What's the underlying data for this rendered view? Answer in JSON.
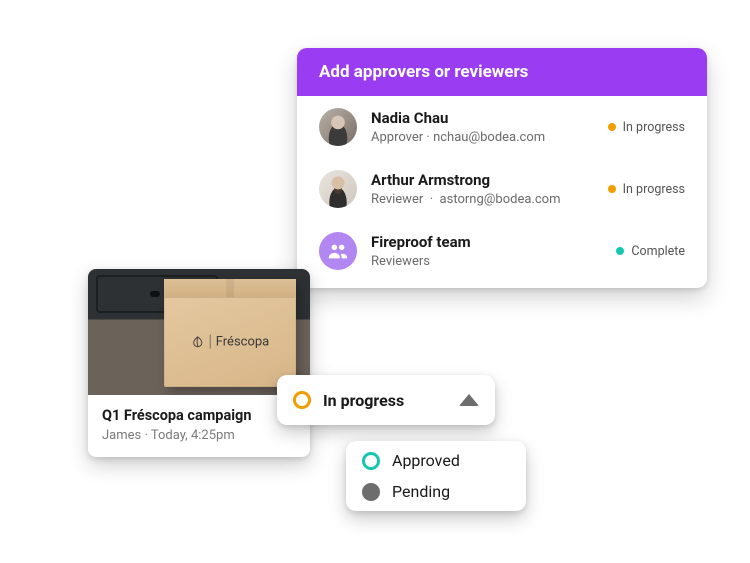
{
  "approvers_panel": {
    "title": "Add approvers or reviewers",
    "rows": [
      {
        "name": "Nadia Chau",
        "role": "Approver",
        "email": "nchau@bodea.com",
        "status_label": "In progress",
        "status_color": "orange",
        "avatar": "nadia"
      },
      {
        "name": "Arthur Armstrong",
        "role": "Reviewer",
        "email": "astorng@bodea.com",
        "status_label": "In progress",
        "status_color": "orange",
        "avatar": "arthur"
      },
      {
        "name": "Fireproof team",
        "role": "Reviewers",
        "email": "",
        "status_label": "Complete",
        "status_color": "teal",
        "avatar": "team"
      }
    ]
  },
  "campaign_card": {
    "box_brand": "Fréscopa",
    "title": "Q1 Fréscopa campaign",
    "author": "James",
    "time": "Today, 4:25pm"
  },
  "status_dropdown": {
    "selected": "In progress",
    "options": [
      {
        "label": "Approved",
        "marker": "ring-teal"
      },
      {
        "label": "Pending",
        "marker": "solid-grey"
      }
    ]
  },
  "colors": {
    "accent_purple": "#9a3df2",
    "in_progress": "#f29d00",
    "complete": "#15c7b0"
  }
}
